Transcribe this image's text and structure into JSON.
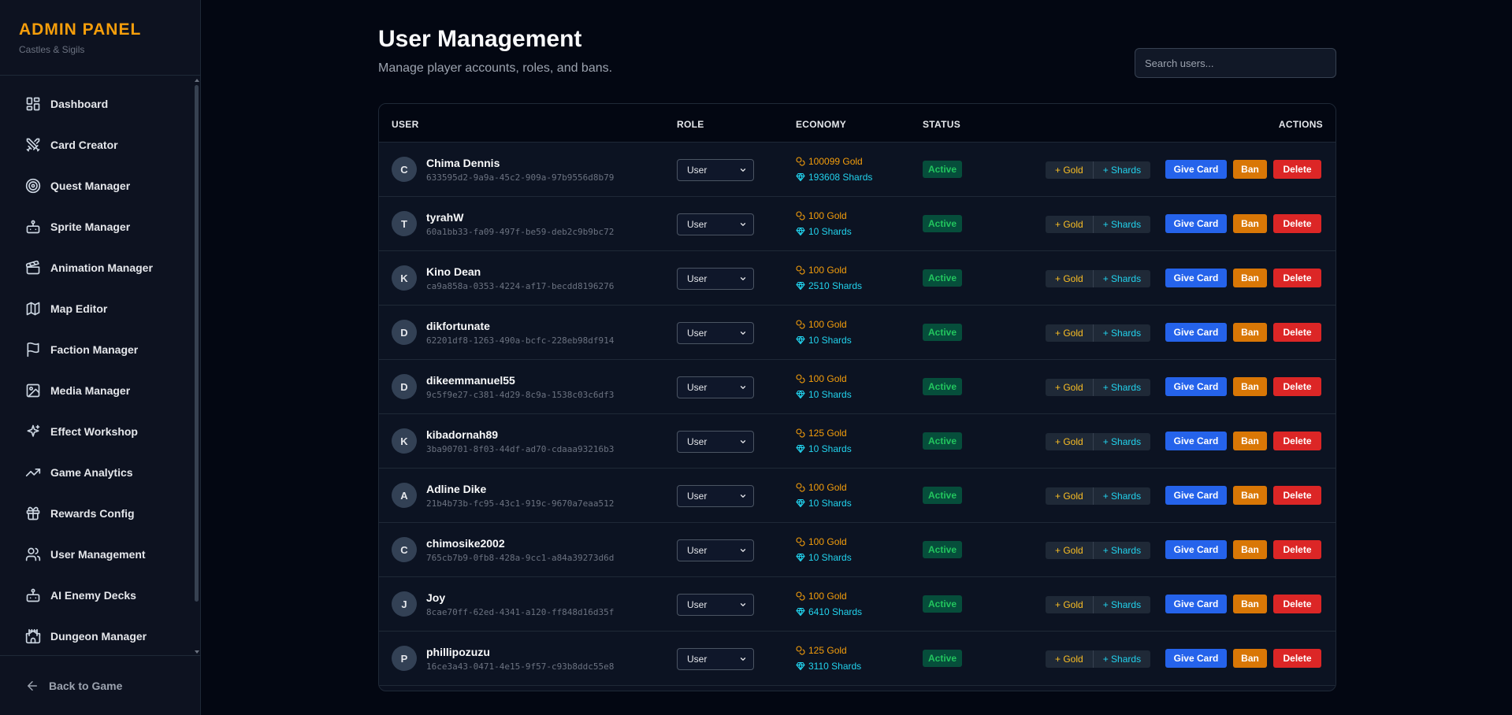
{
  "sidebar": {
    "title": "ADMIN PANEL",
    "subtitle": "Castles & Sigils",
    "items": [
      {
        "label": "Dashboard",
        "icon": "dashboard-icon"
      },
      {
        "label": "Card Creator",
        "icon": "swords-icon"
      },
      {
        "label": "Quest Manager",
        "icon": "target-icon"
      },
      {
        "label": "Sprite Manager",
        "icon": "bot-icon"
      },
      {
        "label": "Animation Manager",
        "icon": "clapperboard-icon"
      },
      {
        "label": "Map Editor",
        "icon": "map-icon"
      },
      {
        "label": "Faction Manager",
        "icon": "flag-icon"
      },
      {
        "label": "Media Manager",
        "icon": "image-icon"
      },
      {
        "label": "Effect Workshop",
        "icon": "sparkles-icon"
      },
      {
        "label": "Game Analytics",
        "icon": "trending-up-icon"
      },
      {
        "label": "Rewards Config",
        "icon": "gift-icon"
      },
      {
        "label": "User Management",
        "icon": "users-icon"
      },
      {
        "label": "AI Enemy Decks",
        "icon": "bot-icon"
      },
      {
        "label": "Dungeon Manager",
        "icon": "castle-icon"
      }
    ],
    "footer": "Back to Game"
  },
  "header": {
    "title": "User Management",
    "subtitle": "Manage player accounts, roles, and bans."
  },
  "search": {
    "placeholder": "Search users..."
  },
  "table": {
    "columns": {
      "user": "USER",
      "role": "ROLE",
      "economy": "ECONOMY",
      "status": "STATUS",
      "actions": "ACTIONS"
    },
    "actions": {
      "add_gold": "+ Gold",
      "add_shards": "+ Shards",
      "give_card": "Give Card",
      "ban": "Ban",
      "delete": "Delete"
    },
    "rows": [
      {
        "initial": "C",
        "name": "Chima Dennis",
        "id": "633595d2-9a9a-45c2-909a-97b9556d8b79",
        "role": "User",
        "gold": "100099 Gold",
        "shards": "193608 Shards",
        "status": "Active"
      },
      {
        "initial": "T",
        "name": "tyrahW",
        "id": "60a1bb33-fa09-497f-be59-deb2c9b9bc72",
        "role": "User",
        "gold": "100 Gold",
        "shards": "10 Shards",
        "status": "Active"
      },
      {
        "initial": "K",
        "name": "Kino Dean",
        "id": "ca9a858a-0353-4224-af17-becdd8196276",
        "role": "User",
        "gold": "100 Gold",
        "shards": "2510 Shards",
        "status": "Active"
      },
      {
        "initial": "D",
        "name": "dikfortunate",
        "id": "62201df8-1263-490a-bcfc-228eb98df914",
        "role": "User",
        "gold": "100 Gold",
        "shards": "10 Shards",
        "status": "Active"
      },
      {
        "initial": "D",
        "name": "dikeemmanuel55",
        "id": "9c5f9e27-c381-4d29-8c9a-1538c03c6df3",
        "role": "User",
        "gold": "100 Gold",
        "shards": "10 Shards",
        "status": "Active"
      },
      {
        "initial": "K",
        "name": "kibadornah89",
        "id": "3ba90701-8f03-44df-ad70-cdaaa93216b3",
        "role": "User",
        "gold": "125 Gold",
        "shards": "10 Shards",
        "status": "Active"
      },
      {
        "initial": "A",
        "name": "Adline Dike",
        "id": "21b4b73b-fc95-43c1-919c-9670a7eaa512",
        "role": "User",
        "gold": "100 Gold",
        "shards": "10 Shards",
        "status": "Active"
      },
      {
        "initial": "C",
        "name": "chimosike2002",
        "id": "765cb7b9-0fb8-428a-9cc1-a84a39273d6d",
        "role": "User",
        "gold": "100 Gold",
        "shards": "10 Shards",
        "status": "Active"
      },
      {
        "initial": "J",
        "name": "Joy",
        "id": "8cae70ff-62ed-4341-a120-ff848d16d35f",
        "role": "User",
        "gold": "100 Gold",
        "shards": "6410 Shards",
        "status": "Active"
      },
      {
        "initial": "P",
        "name": "phillipozuzu",
        "id": "16ce3a43-0471-4e15-9f57-c93b8ddc55e8",
        "role": "User",
        "gold": "125 Gold",
        "shards": "3110 Shards",
        "status": "Active"
      }
    ]
  },
  "colors": {
    "accent": "#f59e0b",
    "background": "#030712",
    "give_card": "#2563eb",
    "ban": "#d97706",
    "delete": "#dc2626",
    "active": "#22c55e",
    "shards": "#22d3ee"
  }
}
